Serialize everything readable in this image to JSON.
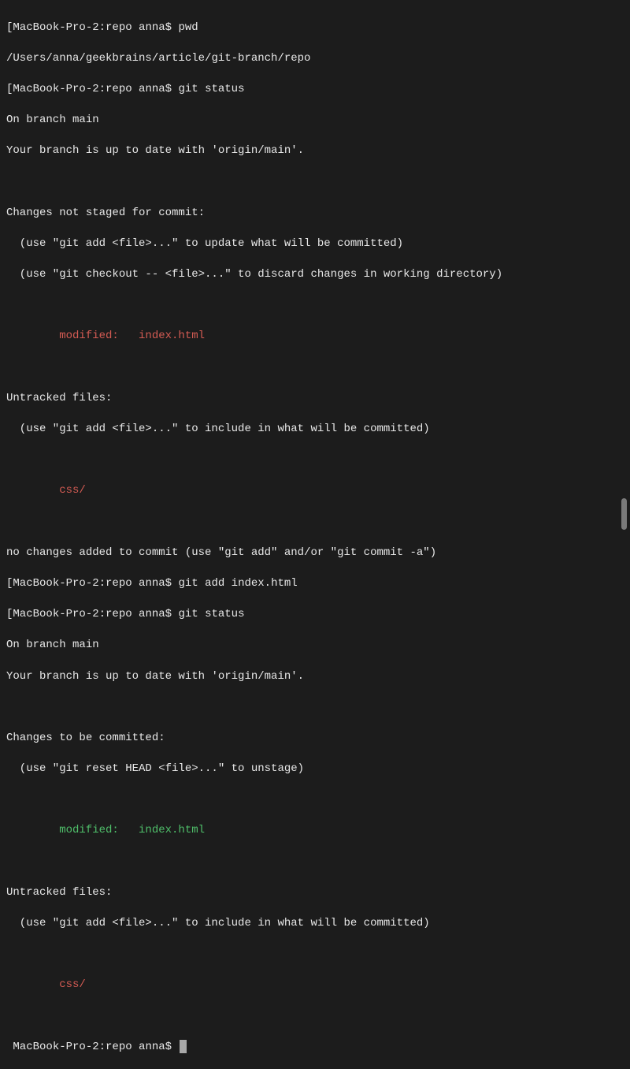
{
  "prompt": {
    "host": "MacBook-Pro-2",
    "dir": "repo",
    "user": "anna",
    "sep": ":",
    "sigil": "$"
  },
  "commands": {
    "pwd": "pwd",
    "status1": "git status",
    "add": "git add index.html",
    "status2": "git status"
  },
  "output": {
    "pwd_path": "/Users/anna/geekbrains/article/git-branch/repo",
    "on_branch": "On branch main",
    "up_to_date": "Your branch is up to date with 'origin/main'.",
    "not_staged_header": "Changes not staged for commit:",
    "hint_add_update": "(use \"git add <file>...\" to update what will be committed)",
    "hint_checkout": "(use \"git checkout -- <file>...\" to discard changes in working directory)",
    "modified_red": "modified:   index.html",
    "untracked_header": "Untracked files:",
    "hint_add_include": "(use \"git add <file>...\" to include in what will be committed)",
    "untracked_red": "css/",
    "no_changes_added": "no changes added to commit (use \"git add\" and/or \"git commit -a\")",
    "to_be_committed": "Changes to be committed:",
    "hint_reset": "(use \"git reset HEAD <file>...\" to unstage)",
    "modified_green": "modified:   index.html"
  }
}
